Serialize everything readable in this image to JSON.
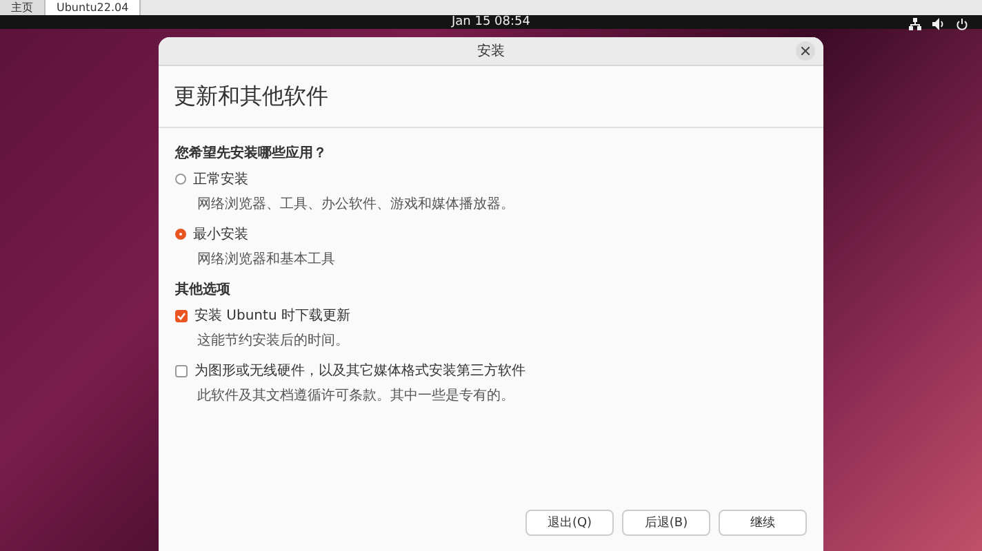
{
  "browser_tabs": [
    {
      "label": "主页",
      "selected": false
    },
    {
      "label": "Ubuntu22.04",
      "selected": true
    }
  ],
  "top_bar": {
    "clock": "Jan 15  08:54"
  },
  "window": {
    "title": "安装",
    "heading": "更新和其他软件"
  },
  "install_question": "您希望先安装哪些应用？",
  "install_options": [
    {
      "label": "正常安装",
      "description": "网络浏览器、工具、办公软件、游戏和媒体播放器。",
      "selected": false
    },
    {
      "label": "最小安装",
      "description": "网络浏览器和基本工具",
      "selected": true
    }
  ],
  "other_options_title": "其他选项",
  "other_options": [
    {
      "label": "安装 Ubuntu 时下载更新",
      "description": "这能节约安装后的时间。",
      "checked": true
    },
    {
      "label": "为图形或无线硬件，以及其它媒体格式安装第三方软件",
      "description": "此软件及其文档遵循许可条款。其中一些是专有的。",
      "checked": false
    }
  ],
  "buttons": [
    "退出(Q)",
    "后退(B)",
    "继续"
  ]
}
